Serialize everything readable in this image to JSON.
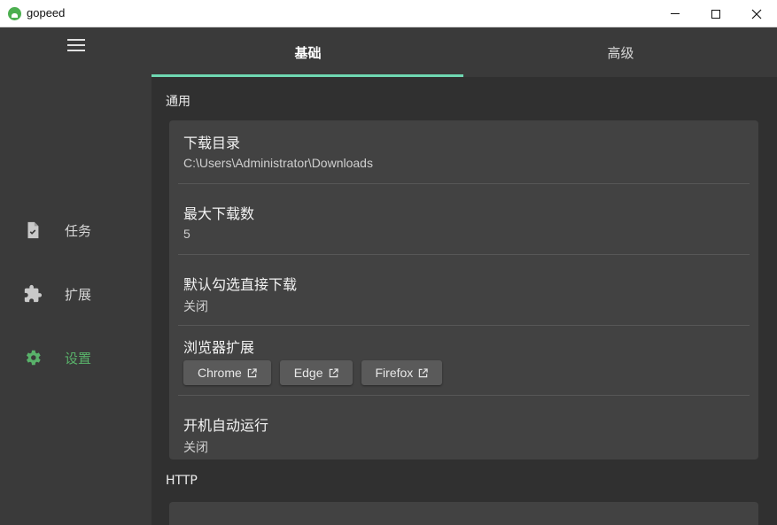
{
  "window": {
    "title": "gopeed",
    "minimize_icon": "minimize-icon",
    "maximize_icon": "maximize-icon",
    "close_icon": "close-icon",
    "brand_color": "#4caf50"
  },
  "sidebar": {
    "menu_icon": "hamburger-menu-icon",
    "items": [
      {
        "label": "任务",
        "icon": "task-file-icon",
        "active": false
      },
      {
        "label": "扩展",
        "icon": "puzzle-extension-icon",
        "active": false
      },
      {
        "label": "设置",
        "icon": "gear-icon",
        "active": true
      }
    ],
    "active_color": "#59b26a"
  },
  "tabs": [
    {
      "label": "基础",
      "active": true
    },
    {
      "label": "高级",
      "active": false
    }
  ],
  "tab_indicator_color": "#6fd8b2",
  "sections": {
    "general": {
      "title": "通用",
      "rows": {
        "download_dir": {
          "title": "下载目录",
          "value": "C:\\Users\\Administrator\\Downloads"
        },
        "max_downloads": {
          "title": "最大下载数",
          "value": "5"
        },
        "default_direct": {
          "title": "默认勾选直接下载",
          "value": "关闭"
        },
        "browser_ext": {
          "title": "浏览器扩展",
          "buttons": [
            {
              "label": "Chrome",
              "icon": "external-link-icon"
            },
            {
              "label": "Edge",
              "icon": "external-link-icon"
            },
            {
              "label": "Firefox",
              "icon": "external-link-icon"
            }
          ]
        },
        "autostart": {
          "title": "开机自动运行",
          "value": "关闭"
        }
      }
    },
    "http": {
      "title": "HTTP"
    }
  }
}
